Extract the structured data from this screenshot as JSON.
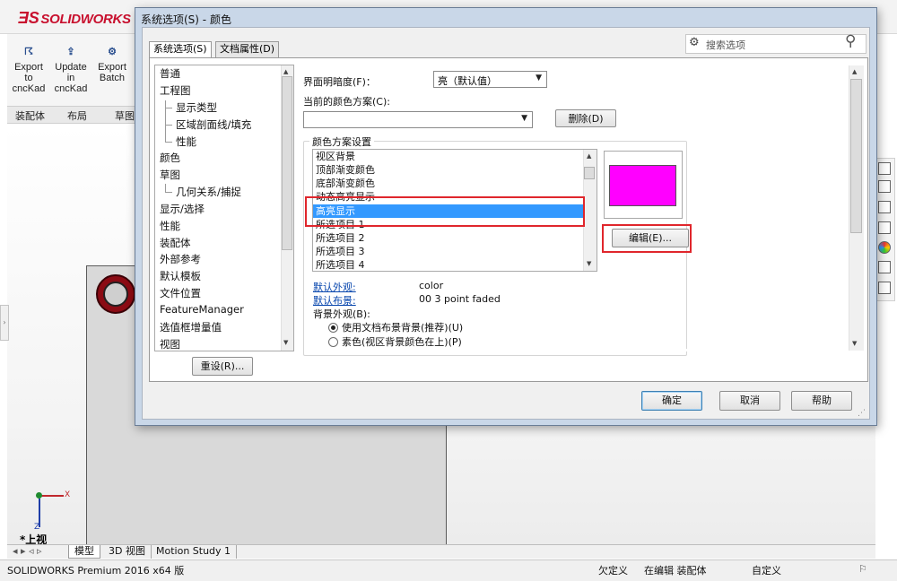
{
  "app": {
    "brand": "SOLIDWORKS",
    "ribbon": [
      {
        "label_lines": [
          "Export",
          "to",
          "cncKad"
        ]
      },
      {
        "label_lines": [
          "Update",
          "in",
          "cncKad"
        ]
      },
      {
        "label_lines": [
          "Export",
          "Batch"
        ]
      }
    ],
    "command_tabs": [
      "装配体",
      "布局",
      "草图"
    ],
    "view_label": "*上视",
    "triad": {
      "x": "X",
      "z": "Z"
    },
    "bottom_tabs": [
      "模型",
      "3D 视图",
      "Motion Study 1"
    ],
    "status": {
      "product": "SOLIDWORKS Premium 2016 x64 版",
      "state1": "欠定义",
      "state2": "在编辑 装配体",
      "state3": "自定义"
    }
  },
  "dialog": {
    "title": "系统选项(S) - 颜色",
    "tabs": [
      "系统选项(S)",
      "文档属性(D)"
    ],
    "search_placeholder": "搜索选项",
    "tree": {
      "items": [
        {
          "label": "普通",
          "level": 0
        },
        {
          "label": "工程图",
          "level": 0
        },
        {
          "label": "显示类型",
          "level": 1
        },
        {
          "label": "区域剖面线/填充",
          "level": 1
        },
        {
          "label": "性能",
          "level": 1
        },
        {
          "label": "颜色",
          "level": 0,
          "selected": true
        },
        {
          "label": "草图",
          "level": 0
        },
        {
          "label": "几何关系/捕捉",
          "level": 1
        },
        {
          "label": "显示/选择",
          "level": 0
        },
        {
          "label": "性能",
          "level": 0
        },
        {
          "label": "装配体",
          "level": 0
        },
        {
          "label": "外部参考",
          "level": 0
        },
        {
          "label": "默认模板",
          "level": 0
        },
        {
          "label": "文件位置",
          "level": 0
        },
        {
          "label": "FeatureManager",
          "level": 0
        },
        {
          "label": "选值框增量值",
          "level": 0
        },
        {
          "label": "视图",
          "level": 0
        }
      ]
    },
    "reset_label": "重设(R)...",
    "brightness_label": "界面明暗度(F)：",
    "brightness_value": "亮（默认值）",
    "scheme_label": "当前的颜色方案(C):",
    "scheme_value": "",
    "delete_label": "删除(D)",
    "group_title": "颜色方案设置",
    "color_items": [
      {
        "label": "视区背景"
      },
      {
        "label": "顶部渐变颜色"
      },
      {
        "label": "底部渐变颜色"
      },
      {
        "label": "动态高亮显示"
      },
      {
        "label": "高亮显示",
        "selected": true
      },
      {
        "label": "所选项目 1"
      },
      {
        "label": "所选项目 2"
      },
      {
        "label": "所选项目 3"
      },
      {
        "label": "所选项目 4"
      }
    ],
    "swatch_color": "#ff00ff",
    "edit_label": "编辑(E)...",
    "default_appearance_label": "默认外观:",
    "default_appearance_value": "color",
    "default_scene_label": "默认布景:",
    "default_scene_value": "00 3 point faded",
    "bg_appearance_label": "背景外观(B):",
    "radios": [
      {
        "label": "使用文档布景背景(推荐)(U)",
        "checked": true
      },
      {
        "label": "素色(视区背景颜色在上)(P)",
        "checked": false
      }
    ],
    "ok_label": "确定",
    "cancel_label": "取消",
    "help_label": "帮助"
  },
  "colors": {
    "highlight_select": "#3399ff",
    "annotation_red": "#e0262c",
    "brand_red": "#c8102e"
  }
}
